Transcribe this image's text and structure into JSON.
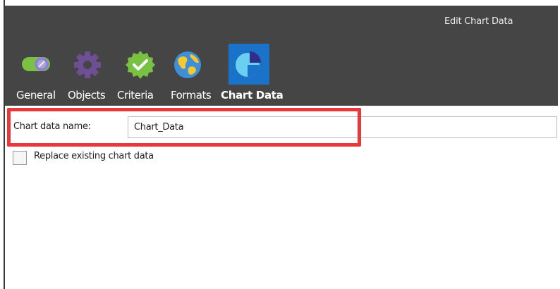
{
  "window": {
    "title": "Edit Chart Data"
  },
  "tabs": [
    {
      "label": "General",
      "icon": "toggle-switch-icon"
    },
    {
      "label": "Objects",
      "icon": "gear-icon"
    },
    {
      "label": "Criteria",
      "icon": "verified-badge-icon"
    },
    {
      "label": "Formats",
      "icon": "globe-icon"
    },
    {
      "label": "Chart Data",
      "icon": "pie-chart-icon",
      "active": true
    }
  ],
  "form": {
    "chart_name_label": "Chart data name:",
    "chart_name_value": "Chart_Data",
    "replace_label": "Replace existing chart data",
    "replace_checked": false
  },
  "colors": {
    "header_bg": "#454545",
    "active_tab_bg": "#1a73c9",
    "highlight": "#e8383b",
    "toggle_green": "#7cc242",
    "gear_purple": "#6e4f96",
    "badge_green": "#79c143",
    "globe_blue": "#3f8fd8"
  }
}
